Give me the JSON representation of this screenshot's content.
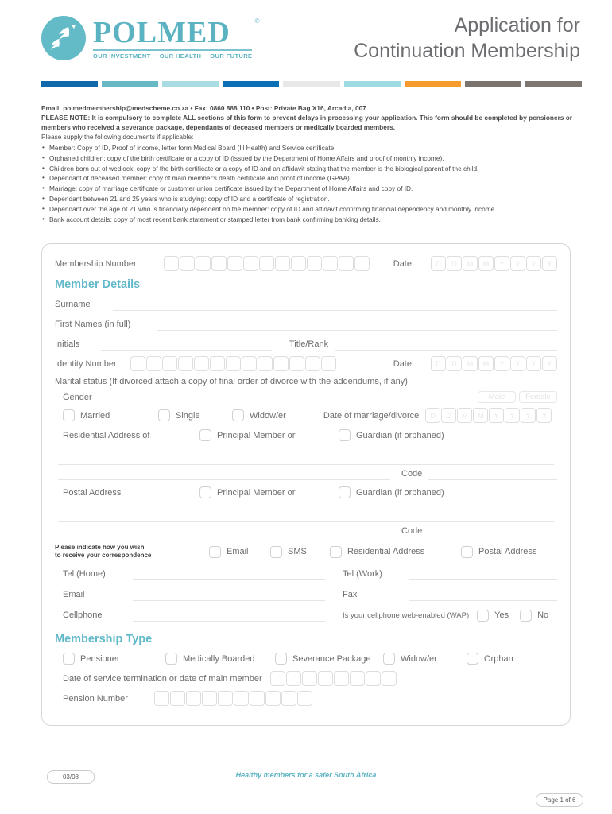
{
  "header": {
    "logo": {
      "brand": "POLMED",
      "registered_mark": "®",
      "tagline_parts": [
        "OUR INVESTMENT",
        "OUR HEALTH",
        "OUR FUTURE"
      ],
      "circle_color": "#63bbc8",
      "text_color": "#5bb3c2",
      "icon": "dolphin-icon"
    },
    "title_line1": "Application for",
    "title_line2": "Continuation Membership",
    "title_color": "#6d6e71"
  },
  "colorbar": {
    "segments": [
      "#1169ab",
      "#68b9c4",
      "#a9dce3",
      "#0a6fb5",
      "#e8e8e8",
      "#9edbe3",
      "#f59a2c",
      "#7a736e",
      "#7d7671"
    ]
  },
  "intro": {
    "contact": "Email: polmedmembership@medscheme.co.za • Fax: 0860 888 110 • Post: Private Bag X16, Arcadia, 007",
    "note_label": "PLEASE NOTE:",
    "note_body": " It is compulsory to complete ALL sections of this form to prevent delays in processing your application. This form should be completed by pensioners or members who received a severance package, dependants of deceased members or medically boarded members.",
    "please_supply": "Please supply the following documents if applicable:",
    "bullets": [
      "Member: Copy of ID, Proof of income, letter form Medical Board (Ill Health) and Service certificate.",
      "Orphaned children: copy of the birth certificate or a copy of ID (issued by the Department of Home Affairs and proof of monthly income).",
      "Children born out of wedlock: copy of the birth certificate or a copy of ID and an affidavit stating that the member is the biological parent of the child.",
      "Dependant of deceased member: copy of main member's death certificate and proof of income (GPAA).",
      "Marriage: copy of marriage certificate or customer union certificate issued by the Department of Home Affairs and copy of ID.",
      "Dependant between 21 and 25 years who is studying: copy of ID and a certificate of registration.",
      "Dependant over the age of 21 who is financially dependent on the member: copy of ID and affidavit confirming financial dependency and monthly income.",
      "Bank account details: copy of most recent bank statement or stamped letter from bank confirming banking details."
    ]
  },
  "form": {
    "membership_number_label": "Membership Number",
    "membership_number_boxes": 13,
    "date_label": "Date",
    "date_placeholders": [
      "D",
      "D",
      "M",
      "M",
      "Y",
      "Y",
      "Y",
      "Y"
    ],
    "member_details_heading": "Member Details",
    "surname_label": "Surname",
    "first_names_label": "First Names (in full)",
    "initials_label": "Initials",
    "title_rank_label": "Title/Rank",
    "identity_number_label": "Identity Number",
    "identity_number_boxes": 13,
    "marital_status_label": "Marital status (If divorced attach a copy of final order of divorce with the addendums, if any)",
    "gender_label": "Gender",
    "gender_options": [
      "Male",
      "Female"
    ],
    "marital_options": [
      "Married",
      "Single",
      "Widow/er"
    ],
    "date_marriage_label": "Date of marriage/divorce",
    "residential_address_label": "Residential Address of",
    "postal_address_label": "Postal Address",
    "address_options": [
      "Principal Member or",
      "Guardian (if orphaned)"
    ],
    "code_label": "Code",
    "correspondence_note_line1": "Please indicate how you wish",
    "correspondence_note_line2": "to receive your correspondence",
    "correspondence_options": [
      "Email",
      "SMS",
      "Residential Address",
      "Postal Address"
    ],
    "tel_home_label": "Tel (Home)",
    "tel_work_label": "Tel (Work)",
    "email_label": "Email",
    "fax_label": "Fax",
    "cellphone_label": "Cellphone",
    "wap_question": "Is your cellphone web-enabled (WAP)",
    "wap_options": [
      "Yes",
      "No"
    ],
    "membership_type_heading": "Membership Type",
    "membership_type_options": [
      "Pensioner",
      "Medically Boarded",
      "Severance Package",
      "Widow/er",
      "Orphan"
    ],
    "service_termination_label": "Date of service termination or date of main member",
    "service_termination_boxes": 8,
    "pension_number_label": "Pension Number",
    "pension_number_boxes": 10,
    "accent_color": "#62b9c9"
  },
  "footer": {
    "revision": "03/08",
    "tagline": "Healthy members for a safer South Africa",
    "page": "Page 1 of 6"
  }
}
